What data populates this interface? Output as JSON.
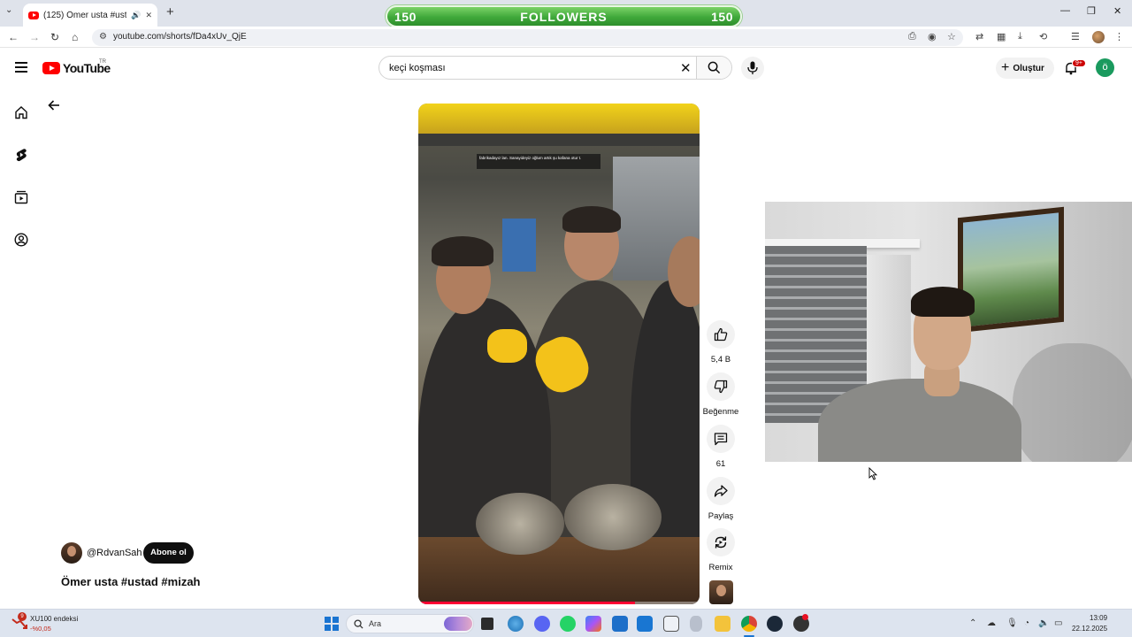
{
  "browser": {
    "tab_title": "(125) Ömer usta #ustad #m",
    "url": "youtube.com/shorts/fDa4xUv_QjE"
  },
  "overlay": {
    "left_count": "150",
    "label": "FOLLOWERS",
    "right_count": "150"
  },
  "youtube": {
    "logo_text": "YouTube",
    "country_code": "TR",
    "search_value": "keçi koşması",
    "create_label": "Oluştur",
    "notification_badge": "9+",
    "avatar_letter": "ö"
  },
  "short": {
    "caption": "fabrikadayız lan. Sanayideyiz oğlum artık şu kafana otur t.",
    "channel": "@RdvanSah",
    "subscribe_label": "Abone ol",
    "title": "Ömer usta #ustad #mizah",
    "progress": 0.77
  },
  "actions": {
    "like_count": "5,4 B",
    "dislike_label": "Beğenme",
    "comment_count": "61",
    "share_label": "Paylaş",
    "remix_label": "Remix"
  },
  "taskbar": {
    "stock_name": "XU100 endeksi",
    "stock_change": "-%0,05",
    "stock_badge": "9",
    "search_label": "Ara",
    "time": "13:09",
    "date": "22.12.2025"
  },
  "colors": {
    "youtube_red": "#ff0000",
    "followers_green": "#3fa83a",
    "subscribe_bg": "#0f0f0f"
  }
}
